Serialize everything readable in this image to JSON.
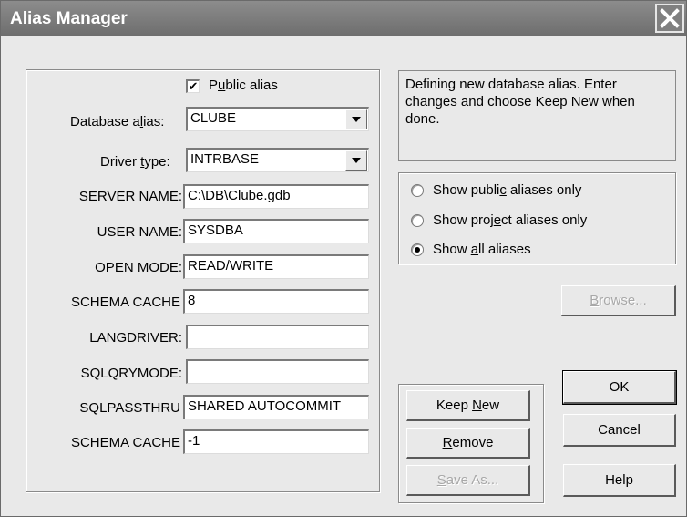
{
  "window": {
    "title": "Alias Manager"
  },
  "left": {
    "public_alias": {
      "label_pre": "P",
      "label_acc": "u",
      "label_post": "blic alias",
      "checked": true
    },
    "database_alias": {
      "label_pre": "Database a",
      "label_acc": "l",
      "label_post": "ias:",
      "value": "CLUBE"
    },
    "driver_type": {
      "label_pre": "Driver ",
      "label_acc": "t",
      "label_post": "ype:",
      "value": "INTRBASE"
    },
    "params": [
      {
        "label": "SERVER NAME:",
        "value": "C:\\DB\\Clube.gdb"
      },
      {
        "label": "USER NAME:",
        "value": "SYSDBA"
      },
      {
        "label": "OPEN MODE:",
        "value": "READ/WRITE"
      },
      {
        "label": "SCHEMA CACHE",
        "value": "8"
      },
      {
        "label": "LANGDRIVER:",
        "value": ""
      },
      {
        "label": "SQLQRYMODE:",
        "value": ""
      },
      {
        "label": "SQLPASSTHRU",
        "value": "SHARED AUTOCOMMIT"
      },
      {
        "label": "SCHEMA CACHE",
        "value": "-1"
      }
    ]
  },
  "info": {
    "line1": "Defining new database alias. Enter",
    "line2": "changes and choose Keep New when",
    "line3": "done."
  },
  "filter": {
    "options": [
      {
        "pre": "Show publi",
        "acc": "c",
        "post": " aliases only",
        "selected": false
      },
      {
        "pre": "Show proj",
        "acc": "e",
        "post": "ct aliases only",
        "selected": false
      },
      {
        "pre": "Show ",
        "acc": "a",
        "post": "ll aliases",
        "selected": true
      }
    ]
  },
  "buttons": {
    "browse": {
      "pre": "",
      "acc": "B",
      "post": "rowse..."
    },
    "keep_new": {
      "pre": "Keep ",
      "acc": "N",
      "post": "ew"
    },
    "remove": {
      "pre": "",
      "acc": "R",
      "post": "emove"
    },
    "save_as": {
      "pre": "",
      "acc": "S",
      "post": "ave As..."
    },
    "ok": "OK",
    "cancel": "Cancel",
    "help": "Help"
  }
}
